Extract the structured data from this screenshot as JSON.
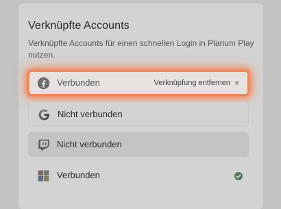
{
  "section": {
    "title": "Verknüpfte Accounts",
    "description": "Verknüpfte Accounts für einen schnellen Login in Plarium Play nutzen."
  },
  "accounts": [
    {
      "provider": "facebook",
      "status": "Verbunden",
      "action": "Verknüpfung entfernen",
      "action_icon": "×",
      "highlighted": true
    },
    {
      "provider": "google",
      "status": "Nicht verbunden"
    },
    {
      "provider": "twitch",
      "status": "Nicht verbunden"
    },
    {
      "provider": "microsoft",
      "status": "Verbunden",
      "badge": "check-icon"
    }
  ],
  "colors": {
    "highlight": "#f08a52",
    "facebook": "#1877f2",
    "twitch": "#9146ff",
    "check": "#2e7d4f"
  }
}
